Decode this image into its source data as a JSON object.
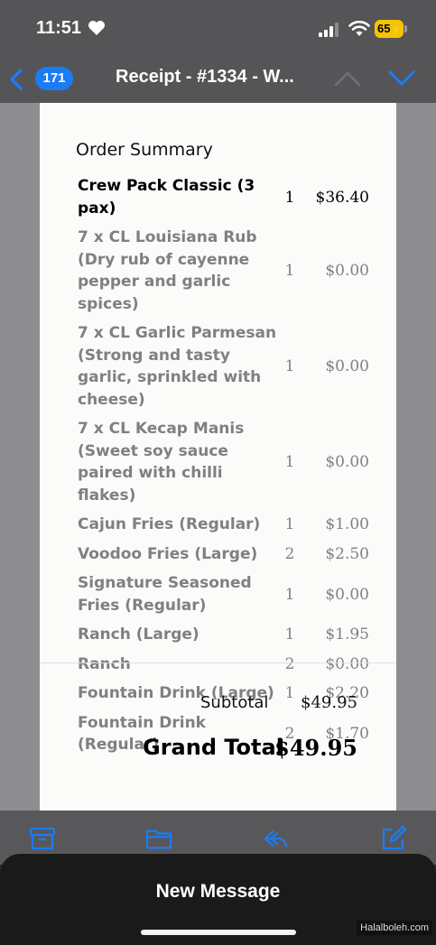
{
  "status_bar": {
    "time": "11:51",
    "battery_level": "65"
  },
  "nav": {
    "unread_count": "171",
    "title": "Receipt - #1334 - W..."
  },
  "receipt": {
    "section_title": "Order Summary",
    "items": [
      {
        "name": "Crew Pack Classic (3 pax)",
        "qty": "1",
        "price": "$36.40",
        "main": true
      },
      {
        "name": "7 x CL Louisiana Rub (Dry rub of cayenne pepper and garlic spices)",
        "qty": "1",
        "price": "$0.00"
      },
      {
        "name": "7 x CL Garlic Parmesan (Strong and tasty garlic, sprinkled with cheese)",
        "qty": "1",
        "price": "$0.00"
      },
      {
        "name": "7 x CL Kecap Manis (Sweet soy sauce paired with chilli flakes)",
        "qty": "1",
        "price": "$0.00"
      },
      {
        "name": "Cajun Fries (Regular)",
        "qty": "1",
        "price": "$1.00"
      },
      {
        "name": "Voodoo Fries (Large)",
        "qty": "2",
        "price": "$2.50"
      },
      {
        "name": "Signature Seasoned Fries (Regular)",
        "qty": "1",
        "price": "$0.00"
      },
      {
        "name": "Ranch (Large)",
        "qty": "1",
        "price": "$1.95"
      },
      {
        "name": "Ranch",
        "qty": "2",
        "price": "$0.00"
      },
      {
        "name": "Fountain Drink (Large)",
        "qty": "1",
        "price": "$2.20"
      },
      {
        "name": "Fountain Drink (Regular)",
        "qty": "2",
        "price": "$1.70"
      }
    ],
    "subtotal_label": "Subtotal",
    "subtotal_value": "$49.95",
    "grand_total_label": "Grand Total",
    "grand_total_value": "$49.95"
  },
  "toolbar": {
    "icons": [
      "archive-icon",
      "folder-icon",
      "reply-icon",
      "compose-icon"
    ],
    "accent_color": "#1b7cf5"
  },
  "sheet": {
    "title": "New Message"
  },
  "watermark": "Halalboleh.com"
}
